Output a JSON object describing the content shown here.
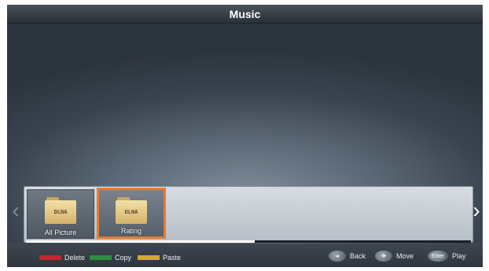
{
  "header": {
    "title": "Music"
  },
  "navigation": {
    "left_arrow": "‹",
    "right_arrow": "›"
  },
  "folders": [
    {
      "badge": "DLNA",
      "label": "All Picture",
      "selected": false
    },
    {
      "badge": "DLNA",
      "label": "Rating",
      "selected": true
    }
  ],
  "footer": {
    "color_keys": [
      {
        "label": "Delete",
        "color": "#c0282c"
      },
      {
        "label": "Copy",
        "color": "#2e8f3e"
      },
      {
        "label": "Paste",
        "color": "#d4a92b"
      }
    ],
    "hints": [
      {
        "glyph": "◂",
        "label": "Back"
      },
      {
        "glyph": "✥",
        "label": "Move"
      },
      {
        "glyph": "Enter",
        "label": "Play"
      }
    ]
  },
  "colors": {
    "selection_accent": "#e87a2e"
  }
}
